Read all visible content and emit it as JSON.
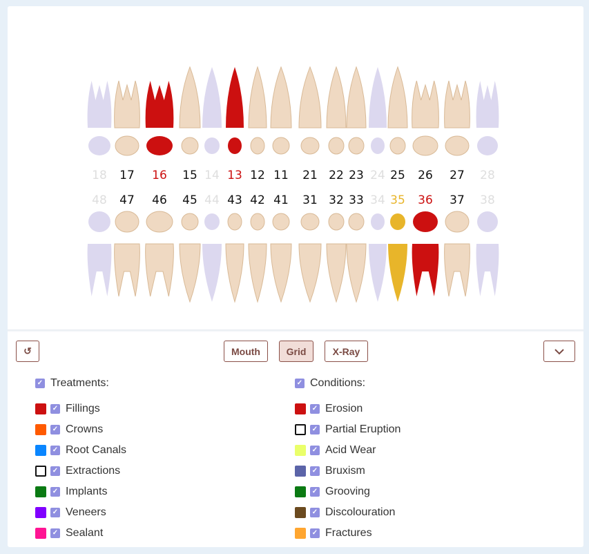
{
  "upper_numbers": [
    "18",
    "17",
    "16",
    "15",
    "14",
    "13",
    "12",
    "11",
    "21",
    "22",
    "23",
    "24",
    "25",
    "26",
    "27",
    "28"
  ],
  "lower_numbers": [
    "48",
    "47",
    "46",
    "45",
    "44",
    "43",
    "42",
    "41",
    "31",
    "32",
    "33",
    "34",
    "35",
    "36",
    "37",
    "38"
  ],
  "upper_status": [
    "missing",
    "normal",
    "filling",
    "normal",
    "missing",
    "filling",
    "normal",
    "normal",
    "normal",
    "normal",
    "normal",
    "missing",
    "normal",
    "normal",
    "normal",
    "missing"
  ],
  "lower_status": [
    "missing",
    "normal",
    "normal",
    "normal",
    "missing",
    "normal",
    "normal",
    "normal",
    "normal",
    "normal",
    "normal",
    "missing",
    "fracture",
    "filling",
    "normal",
    "missing"
  ],
  "colors": {
    "tooth": "#efd9c2",
    "tooth_shade": "#d8b996",
    "missing": "#dcd8ef",
    "missing_num": "#dedede",
    "filling": "#cc1010",
    "fracture": "#e8b52a",
    "number": "#111111"
  },
  "toolbar": {
    "reset_icon": "↺",
    "mouth_label": "Mouth",
    "grid_label": "Grid",
    "xray_label": "X-Ray",
    "collapse_icon": "chevron-down-icon",
    "active_view": "Grid"
  },
  "treatments": {
    "title": "Treatments:",
    "items": [
      {
        "label": "Fillings",
        "color": "#cc1010",
        "outline": false
      },
      {
        "label": "Crowns",
        "color": "#ff5a00",
        "outline": false
      },
      {
        "label": "Root Canals",
        "color": "#0a86ff",
        "outline": false
      },
      {
        "label": "Extractions",
        "color": "#ffffff",
        "outline": true
      },
      {
        "label": "Implants",
        "color": "#0b7a13",
        "outline": false
      },
      {
        "label": "Veneers",
        "color": "#8000ff",
        "outline": false
      },
      {
        "label": "Sealant",
        "color": "#ff1493",
        "outline": false
      }
    ]
  },
  "conditions": {
    "title": "Conditions:",
    "items": [
      {
        "label": "Erosion",
        "color": "#cc1010",
        "outline": false
      },
      {
        "label": "Partial Eruption",
        "color": "#ffffff",
        "outline": true
      },
      {
        "label": "Acid Wear",
        "color": "#eaff6a",
        "outline": false
      },
      {
        "label": "Bruxism",
        "color": "#5b64a8",
        "outline": false
      },
      {
        "label": "Grooving",
        "color": "#0b7a13",
        "outline": false
      },
      {
        "label": "Discolouration",
        "color": "#6b4a1f",
        "outline": false
      },
      {
        "label": "Fractures",
        "color": "#ffa630",
        "outline": false
      }
    ]
  }
}
